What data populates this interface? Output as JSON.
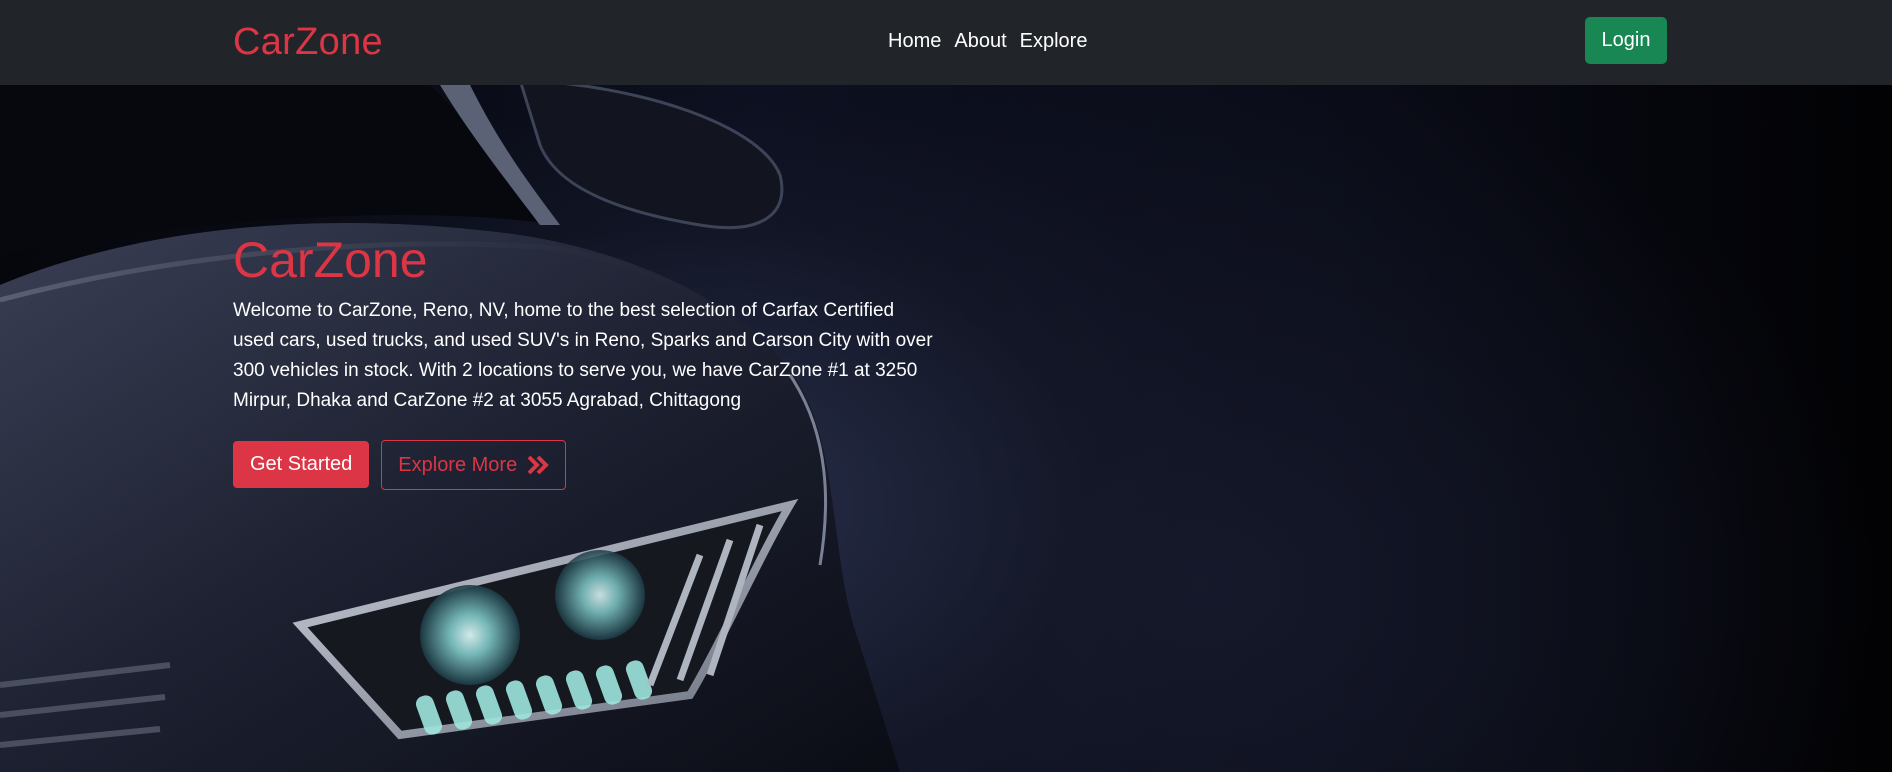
{
  "nav": {
    "brand": "CarZone",
    "links": [
      {
        "label": "Home"
      },
      {
        "label": "About"
      },
      {
        "label": "Explore"
      }
    ],
    "login_label": "Login"
  },
  "hero": {
    "title": "CarZone",
    "description": "Welcome to CarZone, Reno, NV, home to the best selection of Carfax Certified used cars, used trucks, and used SUV's in Reno, Sparks and Carson City with over 300 vehicles in stock. With 2 locations to serve you, we have CarZone #1 at 3250 Mirpur, Dhaka and CarZone #2 at 3055 Agrabad, Chittagong",
    "primary_button": "Get Started",
    "secondary_button": "Explore More",
    "secondary_icon": "double-chevron-right-icon",
    "background_image": "car-headlight-photo"
  },
  "colors": {
    "accent": "#dc3545",
    "navbar": "#212529",
    "login": "#198754"
  }
}
